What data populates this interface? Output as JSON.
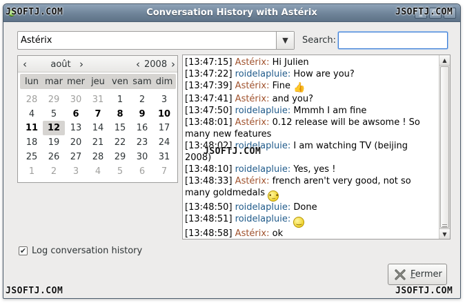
{
  "window": {
    "title": "Conversation History with Astérix",
    "buttons": [
      "_",
      "□",
      "×"
    ]
  },
  "watermark": "JSOFTJ.COM",
  "contact": {
    "selected": "Astérix"
  },
  "search": {
    "label": "Search:",
    "value": ""
  },
  "calendar": {
    "month": "août",
    "year": "2008",
    "prev": "‹",
    "next": "›",
    "day_names": [
      "lun",
      "mar",
      "mer",
      "jeu",
      "ven",
      "sam",
      "dim"
    ],
    "weeks": [
      [
        "28",
        "29",
        "30",
        "31",
        "1",
        "2",
        "3"
      ],
      [
        "4",
        "5",
        "6",
        "7",
        "8",
        "9",
        "10"
      ],
      [
        "11",
        "12",
        "13",
        "14",
        "15",
        "16",
        "17"
      ],
      [
        "18",
        "19",
        "20",
        "21",
        "22",
        "23",
        "24"
      ],
      [
        "25",
        "26",
        "27",
        "28",
        "29",
        "30",
        "31"
      ],
      [
        "1",
        "2",
        "3",
        "4",
        "5",
        "6",
        "7"
      ]
    ],
    "selected_day": "12"
  },
  "conversation": [
    {
      "time": "[13:47:15]",
      "nick": "Astérix:",
      "who": "a",
      "text": "Hi Julien"
    },
    {
      "time": "[13:47:22]",
      "nick": "roidelapluie:",
      "who": "r",
      "text": "How are you?"
    },
    {
      "time": "[13:47:39]",
      "nick": "Astérix:",
      "who": "a",
      "text": "Fine",
      "emoticon": "thumbs-up"
    },
    {
      "time": "[13:47:41]",
      "nick": "Astérix:",
      "who": "a",
      "text": "and you?"
    },
    {
      "time": "[13:47:50]",
      "nick": "roidelapluie:",
      "who": "r",
      "text": "Mmmh I am fine"
    },
    {
      "time": "[13:48:01]",
      "nick": "Astérix:",
      "who": "a",
      "text": "0.12 release will be awsome ! So many new features"
    },
    {
      "time": "[13:48:02]",
      "nick": "roidelapluie:",
      "who": "r",
      "text": "I am watching TV (beijing 2008)"
    },
    {
      "time": "[13:48:10]",
      "nick": "roidelapluie:",
      "who": "r",
      "text": "Yes, yes !"
    },
    {
      "time": "[13:48:33]",
      "nick": "Astérix:",
      "who": "a",
      "text": "french aren't very good, not so many goldmedals",
      "emoticon": "neutral"
    },
    {
      "time": "[13:48:50]",
      "nick": "roidelapluie:",
      "who": "r",
      "text": "Done"
    },
    {
      "time": "[13:48:51]",
      "nick": "roidelapluie:",
      "who": "r",
      "text": "",
      "emoticon": "smile"
    },
    {
      "time": "[13:48:58]",
      "nick": "Astérix:",
      "who": "a",
      "text": "ok"
    }
  ],
  "log_history": {
    "label": "Log conversation history",
    "checked": true
  },
  "close_button": {
    "label_first": "F",
    "label_rest": "ermer"
  }
}
